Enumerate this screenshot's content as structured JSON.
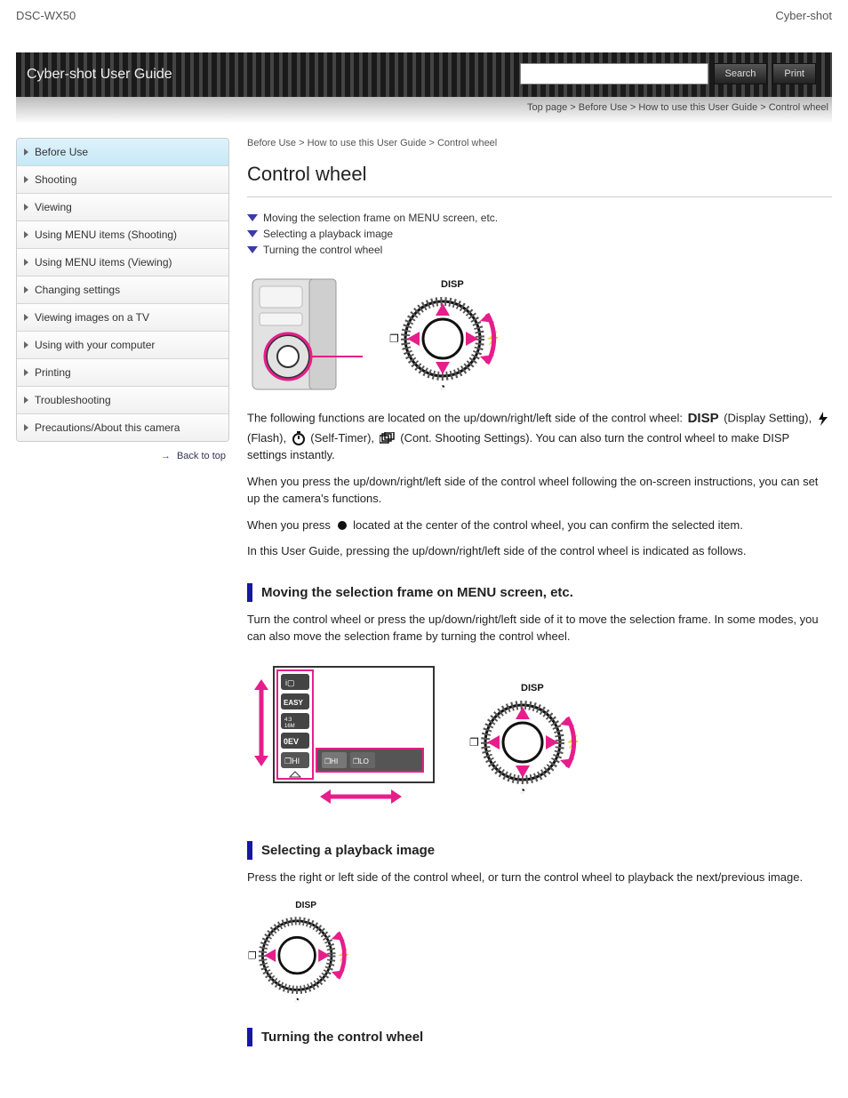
{
  "brand": {
    "left": "DSC-WX50",
    "right": "Cyber-shot"
  },
  "header": {
    "title": "Cyber-shot User Guide"
  },
  "search": {
    "placeholder": "",
    "search_label": "Search",
    "print_label": "Print"
  },
  "top_links": "Top page > Before Use > How to use this User Guide > Control wheel",
  "sidebar": {
    "items": [
      {
        "label": "Before Use"
      },
      {
        "label": "Shooting"
      },
      {
        "label": "Viewing"
      },
      {
        "label": "Using MENU items (Shooting)"
      },
      {
        "label": "Using MENU items (Viewing)"
      },
      {
        "label": "Changing settings"
      },
      {
        "label": "Viewing images on a TV"
      },
      {
        "label": "Using with your computer"
      },
      {
        "label": "Printing"
      },
      {
        "label": "Troubleshooting"
      },
      {
        "label": "Precautions/About this camera"
      }
    ],
    "backtop": "Back to top"
  },
  "breadcrumb": "Before Use > How to use this User Guide > Control wheel",
  "title": "Control wheel",
  "anchors": [
    "Moving the selection frame on MENU screen, etc.",
    "Selecting a playback image",
    "Turning the control wheel"
  ],
  "para1_before": "The following functions are located on the up/down/right/left side of the control wheel: ",
  "para1_disp": " (Display Setting), ",
  "para1_flash": " (Flash), ",
  "para1_timer": " (Self-Timer), ",
  "para1_cont": " (Cont. Shooting Settings). ",
  "para1_after": "You can also turn the control wheel to make DISP settings instantly.",
  "para2": "When you press the up/down/right/left side of the control wheel following the on-screen instructions, you can set up the camera's functions.",
  "para3_before": "When you press ",
  "para3_after": " located at the center of the control wheel, you can confirm the selected item.",
  "para4": "In this User Guide, pressing the up/down/right/left side of the control wheel is indicated as follows.",
  "section_menu": "Moving the selection frame on MENU screen, etc.",
  "para_menu": "Turn the control wheel or press the up/down/right/left side of it to move the selection frame. In some modes, you can also move the selection frame by turning the control wheel.",
  "section_play": "Selecting a playback image",
  "para_play": "Press the right or left side of the control wheel, or turn the control wheel to playback the next/previous image.",
  "section_turn": "Turning the control wheel",
  "icons": {
    "disp_text": "DISP",
    "flash": "flash-icon",
    "timer": "self-timer-icon",
    "cont": "continuous-icon",
    "center": "center-dot-icon"
  }
}
